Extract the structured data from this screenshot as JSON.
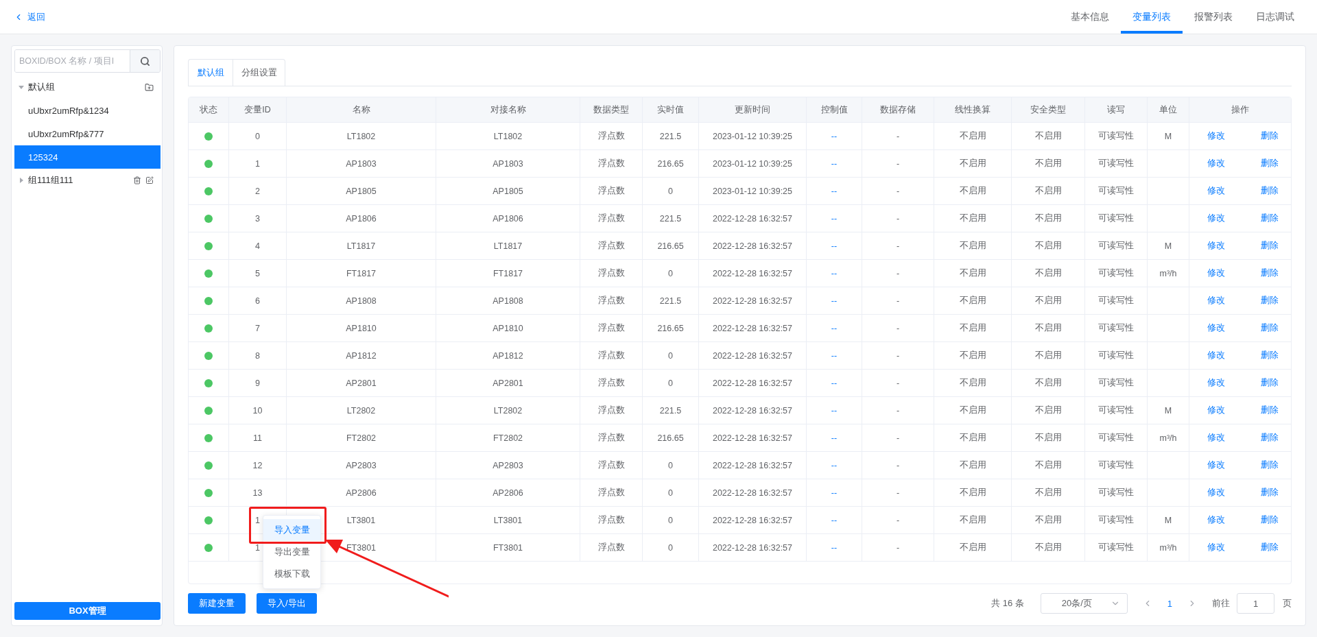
{
  "back_link": "返回",
  "top_tabs": [
    {
      "label": "基本信息",
      "selected": false
    },
    {
      "label": "变量列表",
      "selected": true
    },
    {
      "label": "报警列表",
      "selected": false
    },
    {
      "label": "日志调试",
      "selected": false
    }
  ],
  "sidebar": {
    "search": {
      "placeholder": "BOXID/BOX 名称 / 项目I"
    },
    "tree": [
      {
        "label": "默认组",
        "expanded": true,
        "selected": false,
        "children": [
          {
            "label": "uUbxr2umRfp&1234",
            "selected": false
          },
          {
            "label": "uUbxr2umRfp&777",
            "selected": false
          },
          {
            "label": "125324",
            "selected": true
          }
        ]
      },
      {
        "label": "组111组111",
        "expanded": false,
        "selected": false
      }
    ],
    "button": "BOX管理"
  },
  "group_tabs": [
    {
      "label": "默认组",
      "selected": true
    },
    {
      "label": "分组设置",
      "selected": false
    }
  ],
  "table": {
    "columns": [
      "状态",
      "变量ID",
      "名称",
      "对接名称",
      "数据类型",
      "实时值",
      "更新时间",
      "控制值",
      "数据存储",
      "线性换算",
      "安全类型",
      "读写",
      "单位",
      "操作"
    ],
    "rows": [
      {
        "online": true,
        "cells": [
          "",
          "0",
          "LT1802",
          "LT1802",
          "浮点数",
          "221.5",
          "2023-01-12 10:39:25",
          "--",
          "-",
          "不启用",
          "不启用",
          "可读写性",
          "M"
        ],
        "actions": [
          "修改",
          "删除"
        ]
      },
      {
        "online": true,
        "cells": [
          "",
          "1",
          "AP1803",
          "AP1803",
          "浮点数",
          "216.65",
          "2023-01-12 10:39:25",
          "--",
          "-",
          "不启用",
          "不启用",
          "可读写性",
          ""
        ],
        "actions": [
          "修改",
          "删除"
        ]
      },
      {
        "online": true,
        "cells": [
          "",
          "2",
          "AP1805",
          "AP1805",
          "浮点数",
          "0",
          "2023-01-12 10:39:25",
          "--",
          "-",
          "不启用",
          "不启用",
          "可读写性",
          ""
        ],
        "actions": [
          "修改",
          "删除"
        ]
      },
      {
        "online": true,
        "cells": [
          "",
          "3",
          "AP1806",
          "AP1806",
          "浮点数",
          "221.5",
          "2022-12-28 16:32:57",
          "--",
          "-",
          "不启用",
          "不启用",
          "可读写性",
          ""
        ],
        "actions": [
          "修改",
          "删除"
        ]
      },
      {
        "online": true,
        "cells": [
          "",
          "4",
          "LT1817",
          "LT1817",
          "浮点数",
          "216.65",
          "2022-12-28 16:32:57",
          "--",
          "-",
          "不启用",
          "不启用",
          "可读写性",
          "M"
        ],
        "actions": [
          "修改",
          "删除"
        ]
      },
      {
        "online": true,
        "cells": [
          "",
          "5",
          "FT1817",
          "FT1817",
          "浮点数",
          "0",
          "2022-12-28 16:32:57",
          "--",
          "-",
          "不启用",
          "不启用",
          "可读写性",
          "m³/h"
        ],
        "actions": [
          "修改",
          "删除"
        ]
      },
      {
        "online": true,
        "cells": [
          "",
          "6",
          "AP1808",
          "AP1808",
          "浮点数",
          "221.5",
          "2022-12-28 16:32:57",
          "--",
          "-",
          "不启用",
          "不启用",
          "可读写性",
          ""
        ],
        "actions": [
          "修改",
          "删除"
        ]
      },
      {
        "online": true,
        "cells": [
          "",
          "7",
          "AP1810",
          "AP1810",
          "浮点数",
          "216.65",
          "2022-12-28 16:32:57",
          "--",
          "-",
          "不启用",
          "不启用",
          "可读写性",
          ""
        ],
        "actions": [
          "修改",
          "删除"
        ]
      },
      {
        "online": true,
        "cells": [
          "",
          "8",
          "AP1812",
          "AP1812",
          "浮点数",
          "0",
          "2022-12-28 16:32:57",
          "--",
          "-",
          "不启用",
          "不启用",
          "可读写性",
          ""
        ],
        "actions": [
          "修改",
          "删除"
        ]
      },
      {
        "online": true,
        "cells": [
          "",
          "9",
          "AP2801",
          "AP2801",
          "浮点数",
          "0",
          "2022-12-28 16:32:57",
          "--",
          "-",
          "不启用",
          "不启用",
          "可读写性",
          ""
        ],
        "actions": [
          "修改",
          "删除"
        ]
      },
      {
        "online": true,
        "cells": [
          "",
          "10",
          "LT2802",
          "LT2802",
          "浮点数",
          "221.5",
          "2022-12-28 16:32:57",
          "--",
          "-",
          "不启用",
          "不启用",
          "可读写性",
          "M"
        ],
        "actions": [
          "修改",
          "删除"
        ]
      },
      {
        "online": true,
        "cells": [
          "",
          "11",
          "FT2802",
          "FT2802",
          "浮点数",
          "216.65",
          "2022-12-28 16:32:57",
          "--",
          "-",
          "不启用",
          "不启用",
          "可读写性",
          "m³/h"
        ],
        "actions": [
          "修改",
          "删除"
        ]
      },
      {
        "online": true,
        "cells": [
          "",
          "12",
          "AP2803",
          "AP2803",
          "浮点数",
          "0",
          "2022-12-28 16:32:57",
          "--",
          "-",
          "不启用",
          "不启用",
          "可读写性",
          ""
        ],
        "actions": [
          "修改",
          "删除"
        ]
      },
      {
        "online": true,
        "cells": [
          "",
          "13",
          "AP2806",
          "AP2806",
          "浮点数",
          "0",
          "2022-12-28 16:32:57",
          "--",
          "-",
          "不启用",
          "不启用",
          "可读写性",
          ""
        ],
        "actions": [
          "修改",
          "删除"
        ]
      },
      {
        "online": true,
        "cells": [
          "",
          "1",
          "LT3801",
          "LT3801",
          "浮点数",
          "0",
          "2022-12-28 16:32:57",
          "--",
          "-",
          "不启用",
          "不启用",
          "可读写性",
          "M"
        ],
        "actions": [
          "修改",
          "删除"
        ]
      },
      {
        "online": true,
        "cells": [
          "",
          "1",
          "FT3801",
          "FT3801",
          "浮点数",
          "0",
          "2022-12-28 16:32:57",
          "--",
          "-",
          "不启用",
          "不启用",
          "可读写性",
          "m³/h"
        ],
        "actions": [
          "修改",
          "删除"
        ]
      }
    ]
  },
  "footer_buttons": [
    "新建变量",
    "导入/导出"
  ],
  "menu": [
    {
      "label": "导入变量",
      "selected": true
    },
    {
      "label": "导出变量",
      "selected": false
    },
    {
      "label": "模板下载",
      "selected": false
    }
  ],
  "pagination": {
    "total": "共 16 条",
    "page_size": "20条/页",
    "current": "1",
    "goto_label": "前往",
    "goto_value": "1",
    "page_suffix": "页"
  }
}
